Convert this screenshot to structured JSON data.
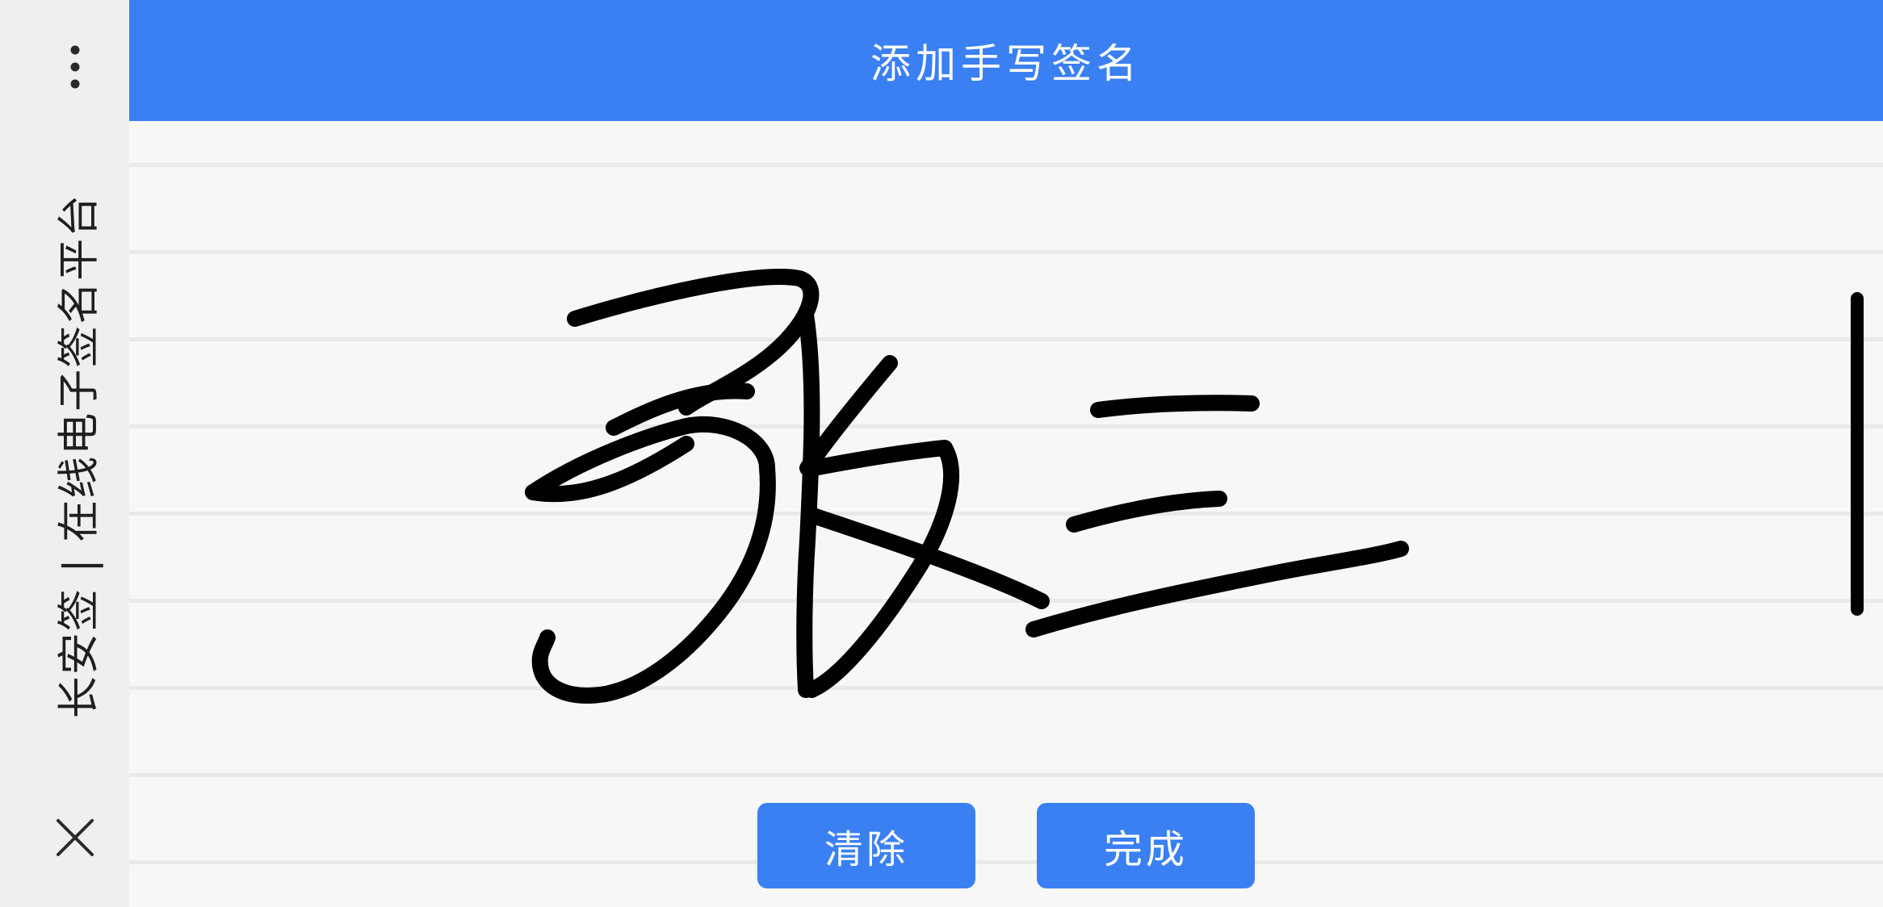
{
  "app": {
    "side_title": "长安签 | 在线电子签名平台",
    "header_title": "添加手写签名"
  },
  "icons": {
    "more": "more-vertical-icon",
    "close": "close-icon"
  },
  "buttons": {
    "clear_label": "清除",
    "done_label": "完成"
  },
  "colors": {
    "primary": "#3a80f3",
    "ink": "#000000",
    "paper": "#f7f7f7",
    "sidebar": "#efefef"
  }
}
